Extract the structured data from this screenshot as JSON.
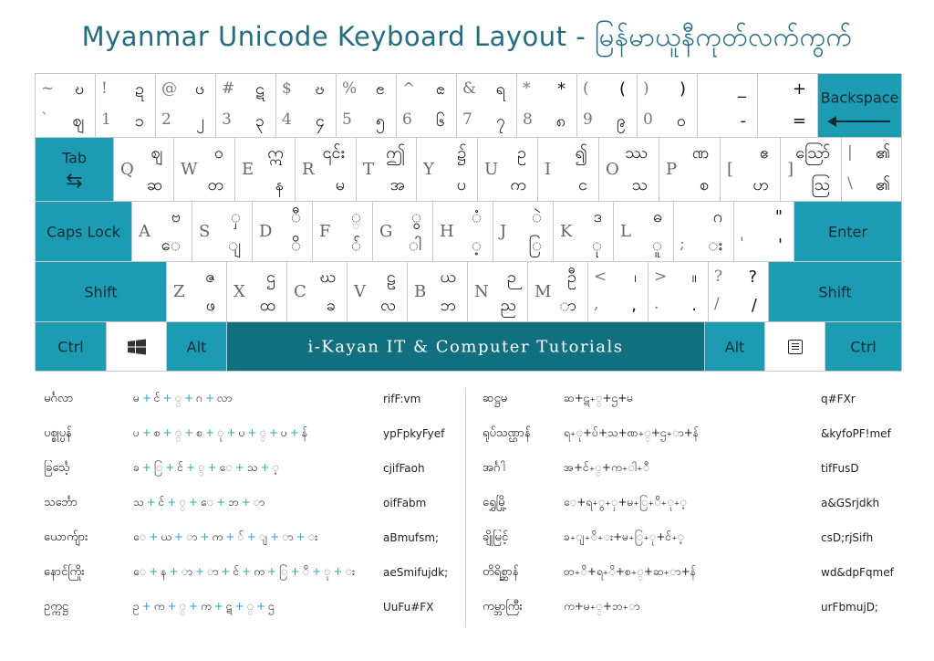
{
  "title": "Myanmar Unicode Keyboard Layout - မြန်မာယူနီကုတ်လက်ကွက်",
  "keyboard": {
    "row1": [
      {
        "tl": "~",
        "bl": "`",
        "tr": "ဎ",
        "br": "ဈ"
      },
      {
        "tl": "!",
        "bl": "1",
        "tr": "ဍ",
        "br": "၁"
      },
      {
        "tl": "@",
        "bl": "2",
        "tr": "ၒ",
        "br": "၂"
      },
      {
        "tl": "#",
        "bl": "3",
        "tr": "ဋ",
        "br": "၃"
      },
      {
        "tl": "$",
        "bl": "4",
        "tr": "ၓ",
        "br": "၄"
      },
      {
        "tl": "%",
        "bl": "5",
        "tr": "ၔ",
        "br": "၅"
      },
      {
        "tl": "^",
        "bl": "6",
        "tr": "ၕ",
        "br": "၆"
      },
      {
        "tl": "&",
        "bl": "7",
        "tr": "ရ",
        "br": "၇"
      },
      {
        "tl": "*",
        "bl": "8",
        "tr": "*",
        "br": "၈"
      },
      {
        "tl": "(",
        "bl": "9",
        "tr": "(",
        "br": "၉"
      },
      {
        "tl": ")",
        "bl": "0",
        "tr": ")",
        "br": "၀"
      },
      {
        "tl": "",
        "bl": "",
        "tr": "_",
        "br": "-"
      },
      {
        "tl": "",
        "bl": "",
        "tr": "+",
        "br": "="
      }
    ],
    "backspace": "Backspace",
    "tab": "Tab",
    "row2": [
      {
        "ml": "Q",
        "tr": "ဈ",
        "br": "ဆ"
      },
      {
        "ml": "W",
        "tr": "ဝ",
        "br": "တ"
      },
      {
        "ml": "E",
        "tr": "ဣ",
        "br": "န"
      },
      {
        "ml": "R",
        "tr": "၎င်း",
        "br": "မ"
      },
      {
        "ml": "T",
        "tr": "ဤ",
        "br": "အ"
      },
      {
        "ml": "Y",
        "tr": "၌",
        "br": "ပ"
      },
      {
        "ml": "U",
        "tr": "ဥ",
        "br": "က"
      },
      {
        "ml": "I",
        "tr": "၍",
        "br": "င"
      },
      {
        "ml": "O",
        "tr": "ဿ",
        "br": "သ"
      },
      {
        "ml": "P",
        "tr": "ဏ",
        "br": "စ"
      },
      {
        "ml": "[",
        "tr": "ဧ",
        "br": "ဟ"
      },
      {
        "ml": "]",
        "tr": "ဪ",
        "br": "ဩ"
      },
      {
        "tl": "|",
        "bl": "\\",
        "tr": "၏",
        "br": "၏"
      }
    ],
    "caps": "Caps Lock",
    "row3": [
      {
        "ml": "A",
        "tr": "ဗ",
        "br": "ေ"
      },
      {
        "ml": "S",
        "tr": "ှ",
        "br": "ျ"
      },
      {
        "ml": "D",
        "tr": "ီ",
        "br": "ိ"
      },
      {
        "ml": "F",
        "tr": "္",
        "br": "်"
      },
      {
        "ml": "G",
        "tr": "ွ",
        "br": "ါ"
      },
      {
        "ml": "H",
        "tr": "ံ",
        "br": "့"
      },
      {
        "ml": "J",
        "tr": "ဲ",
        "br": "ြ"
      },
      {
        "ml": "K",
        "tr": "ဒ",
        "br": "ု"
      },
      {
        "ml": "L",
        "tr": "ဓ",
        "br": "ူ"
      },
      {
        "tl": "",
        "bl": ";",
        "tr": "ဂ",
        "br": "း"
      },
      {
        "tl": "",
        "bl": "'",
        "tr": "\"",
        "br": "'"
      }
    ],
    "enter": "Enter",
    "shift_left": "Shift",
    "row4": [
      {
        "ml": "Z",
        "tr": "ဇ",
        "br": "ဖ"
      },
      {
        "ml": "X",
        "tr": "ဌ",
        "br": "ထ"
      },
      {
        "ml": "C",
        "tr": "ဃ",
        "br": "ခ"
      },
      {
        "ml": "V",
        "tr": "ဠ",
        "br": "လ"
      },
      {
        "ml": "B",
        "tr": "ယ",
        "br": "ဘ"
      },
      {
        "ml": "N",
        "tr": "ဉ",
        "br": "ည"
      },
      {
        "ml": "M",
        "tr": "ဦ",
        "br": "ာ"
      },
      {
        "tl": "<",
        "bl": ",",
        "tr": "၊",
        "br": ","
      },
      {
        "tl": ">",
        "bl": ".",
        "tr": "။",
        "br": "."
      },
      {
        "tl": "?",
        "bl": "/",
        "tr": "?",
        "br": "/"
      }
    ],
    "shift_right": "Shift",
    "ctrl_left": "Ctrl",
    "alt_left": "Alt",
    "space_text": "i-Kayan IT & Computer Tutorials",
    "alt_right": "Alt",
    "ctrl_right": "Ctrl",
    "colors": {
      "teal": "#1b9cb2",
      "dark": "#11707f",
      "title": "#1f6e86",
      "plus": "#2aa7c6"
    }
  },
  "examples_left": [
    {
      "word": "မင်္ဂလာ",
      "seq": [
        "မ",
        "င်",
        "္",
        "ဂ",
        "လာ"
      ],
      "code": "rifF:vm"
    },
    {
      "word": "ပစ္စုပ္ပန်",
      "seq": [
        "ပ",
        "စ",
        "္",
        "စ",
        "ု",
        "ပ",
        "္",
        "ပ",
        "န်"
      ],
      "code": "ypFpkyFyef"
    },
    {
      "word": "ခြင်္သေ့",
      "seq": [
        "ခ",
        "ြ",
        "င်",
        "္",
        "ေ",
        "သ",
        "့"
      ],
      "code": "cjifFaoh"
    },
    {
      "word": "သင်္ဘော",
      "seq": [
        "သ",
        "င်",
        "္",
        "ေ",
        "ဘ",
        "ာ"
      ],
      "code": "oifFabm"
    },
    {
      "word": "ယောက်ျား",
      "seq": [
        "ေ",
        "ယ",
        "ာ",
        "က",
        "်",
        "ျ",
        "ာ",
        "း"
      ],
      "code": "aBmufsm;"
    },
    {
      "word": "နောင်ကြိုး",
      "seq": [
        "ေ",
        "န",
        "ာ",
        "ာ",
        "င်",
        "က",
        "ြ",
        "ိ",
        "ု",
        "း"
      ],
      "code": "aeSmifujdk;"
    },
    {
      "word": "ဥက္ကဋ္ဌ",
      "seq": [
        "ဥ",
        "က",
        "္",
        "က",
        "ဋ",
        "္",
        "ဌ"
      ],
      "code": "UuFu#FX"
    }
  ],
  "examples_right": [
    {
      "word": "ဆဋ္ဌမ",
      "seq": [
        "ဆ",
        "ဋ",
        "္",
        "ဌ",
        "မ"
      ],
      "code": "q#FXr"
    },
    {
      "word": "ရုပ်သဏ္ဌာန်",
      "seq": [
        "ရ",
        "ု",
        "ပ်",
        "သ",
        "ဏ",
        "္",
        "ဌ",
        "ာ",
        "န်"
      ],
      "code": "&kyfoPF!mef"
    },
    {
      "word": "အင်္ဂါ",
      "seq": [
        "အ",
        "င်",
        "္",
        "က",
        "ါ",
        "ီ"
      ],
      "code": "tifFusD"
    },
    {
      "word": "ရွှေမြို့",
      "seq": [
        "ေ",
        "ရ",
        "ွ",
        "ှ",
        "မ",
        "ြ",
        "ိ",
        "ု",
        "့"
      ],
      "code": "a&GSrjdkh"
    },
    {
      "word": "ချိုမြင့်",
      "seq": [
        "ခ",
        "ျ",
        "ိ",
        "း",
        "မ",
        "ြ",
        "ု",
        "င်",
        "့"
      ],
      "code": "csD;rjSifh"
    },
    {
      "word": "တိရိစ္ဆာန်",
      "seq": [
        "တ",
        "ိ",
        "ရ",
        "ိ",
        "စ",
        "္",
        "ဆ",
        "ာ",
        "န်"
      ],
      "code": "wd&dpFqmef"
    },
    {
      "word": "ကမ္ဘာကြီး",
      "seq": [
        "က",
        "မ",
        "္",
        "ဘ",
        "ာ"
      ],
      "code": "urFbmujD;"
    }
  ]
}
